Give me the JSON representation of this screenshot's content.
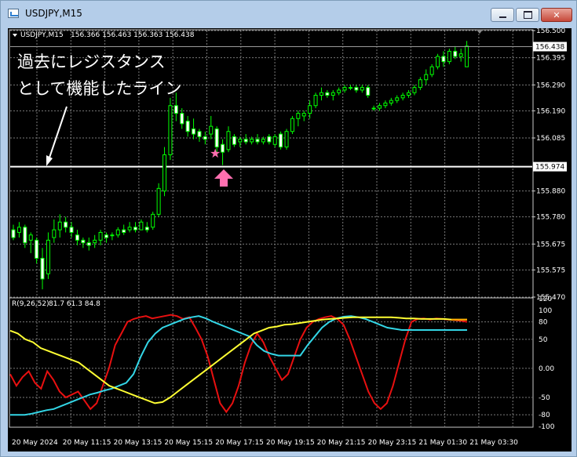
{
  "window": {
    "title": "USDJPY,M15",
    "minimize_label": "",
    "maximize_label": "",
    "close_label": "✕"
  },
  "chart_header": {
    "symbol_timeframe": "USDJPY,M15",
    "ohlc": "156.366 156.463 156.363 156.438"
  },
  "annotation": {
    "line1": "過去にレジスタンス",
    "line2": "として機能したライン",
    "star": "★",
    "arrow": "🡅"
  },
  "indicator_header": {
    "label": "R(9,26,52)",
    "values": "81.7 61.3 84.8"
  },
  "price_axis": {
    "labels": [
      "156.500",
      "156.395",
      "156.290",
      "156.190",
      "156.085",
      "155.880",
      "155.780",
      "155.675",
      "155.575",
      "155.470"
    ],
    "current_price": "156.438",
    "line_price": "155.974"
  },
  "indicator_axis": {
    "labels": [
      "120",
      "100",
      "80",
      "50",
      "0.00",
      "-50",
      "-80",
      "-100"
    ]
  },
  "time_axis": {
    "labels": [
      "20 May 2024",
      "20 May 11:15",
      "20 May 13:15",
      "20 May 15:15",
      "20 May 17:15",
      "20 May 19:15",
      "20 May 21:15",
      "20 May 23:15",
      "21 May 01:30",
      "21 May 03:30"
    ]
  },
  "colors": {
    "candle": "#00ff00",
    "annotation_text": "#ffffff",
    "marker": "#ff6fb0",
    "line_red": "#e81010",
    "line_cyan": "#33d6e6",
    "line_yellow": "#ffff33",
    "line_orange": "#ffa500"
  },
  "chart_data": {
    "type": "candlestick",
    "price_ylim": [
      155.47,
      156.5
    ],
    "horizontal_line": 155.974,
    "candles": [
      [
        155.73,
        155.75,
        155.69,
        155.7
      ],
      [
        155.72,
        155.76,
        155.7,
        155.74
      ],
      [
        155.74,
        155.75,
        155.66,
        155.68
      ],
      [
        155.69,
        155.72,
        155.64,
        155.71
      ],
      [
        155.69,
        155.7,
        155.6,
        155.62
      ],
      [
        155.62,
        155.66,
        155.5,
        155.54
      ],
      [
        155.56,
        155.72,
        155.54,
        155.69
      ],
      [
        155.7,
        155.77,
        155.68,
        155.73
      ],
      [
        155.73,
        155.79,
        155.7,
        155.76
      ],
      [
        155.76,
        155.78,
        155.72,
        155.74
      ],
      [
        155.74,
        155.76,
        155.7,
        155.72
      ],
      [
        155.71,
        155.73,
        155.67,
        155.69
      ],
      [
        155.69,
        155.7,
        155.66,
        155.68
      ],
      [
        155.68,
        155.7,
        155.65,
        155.67
      ],
      [
        155.68,
        155.71,
        155.66,
        155.69
      ],
      [
        155.69,
        155.73,
        155.67,
        155.72
      ],
      [
        155.71,
        155.72,
        155.68,
        155.7
      ],
      [
        155.71,
        155.72,
        155.69,
        155.71
      ],
      [
        155.71,
        155.74,
        155.7,
        155.73
      ],
      [
        155.73,
        155.75,
        155.71,
        155.72
      ],
      [
        155.73,
        155.76,
        155.72,
        155.74
      ],
      [
        155.74,
        155.76,
        155.72,
        155.73
      ],
      [
        155.73,
        155.77,
        155.73,
        155.76
      ],
      [
        155.74,
        155.76,
        155.72,
        155.73
      ],
      [
        155.74,
        155.8,
        155.73,
        155.79
      ],
      [
        155.79,
        155.91,
        155.78,
        155.89
      ],
      [
        155.88,
        156.05,
        155.86,
        156.02
      ],
      [
        156.02,
        156.24,
        156.0,
        156.21
      ],
      [
        156.21,
        156.26,
        156.15,
        156.18
      ],
      [
        156.18,
        156.2,
        156.12,
        156.14
      ],
      [
        156.15,
        156.17,
        156.09,
        156.11
      ],
      [
        156.12,
        156.16,
        156.08,
        156.1
      ],
      [
        156.11,
        156.12,
        156.07,
        156.09
      ],
      [
        156.09,
        156.11,
        156.06,
        156.08
      ],
      [
        156.1,
        156.17,
        156.08,
        156.13
      ],
      [
        156.12,
        156.13,
        156.02,
        156.05
      ],
      [
        156.06,
        156.08,
        155.98,
        156.03
      ],
      [
        156.04,
        156.13,
        156.03,
        156.11
      ],
      [
        156.09,
        156.1,
        156.05,
        156.06
      ],
      [
        156.07,
        156.09,
        156.05,
        156.08
      ],
      [
        156.08,
        156.1,
        156.06,
        156.07
      ],
      [
        156.07,
        156.09,
        156.06,
        156.08
      ],
      [
        156.08,
        156.1,
        156.06,
        156.07
      ],
      [
        156.07,
        156.09,
        156.06,
        156.08
      ],
      [
        156.09,
        156.1,
        156.06,
        156.07
      ],
      [
        156.06,
        156.1,
        156.05,
        156.09
      ],
      [
        156.1,
        156.11,
        156.04,
        156.05
      ],
      [
        156.05,
        156.12,
        156.04,
        156.11
      ],
      [
        156.11,
        156.17,
        156.1,
        156.16
      ],
      [
        156.16,
        156.19,
        156.13,
        156.18
      ],
      [
        156.17,
        156.19,
        156.15,
        156.18
      ],
      [
        156.18,
        156.23,
        156.16,
        156.21
      ],
      [
        156.21,
        156.26,
        156.2,
        156.25
      ],
      [
        156.25,
        156.28,
        156.23,
        156.26
      ],
      [
        156.26,
        156.27,
        156.24,
        156.25
      ],
      [
        156.25,
        156.27,
        156.23,
        156.26
      ],
      [
        156.26,
        156.28,
        156.25,
        156.27
      ],
      [
        156.27,
        156.29,
        156.26,
        156.28
      ],
      [
        156.28,
        156.29,
        156.27,
        156.28
      ],
      [
        156.28,
        156.29,
        156.26,
        156.27
      ],
      [
        156.27,
        156.29,
        156.26,
        156.28
      ],
      [
        156.28,
        156.29,
        156.24,
        156.25
      ],
      [
        156.2,
        156.21,
        156.19,
        156.2
      ],
      [
        156.2,
        156.22,
        156.19,
        156.21
      ],
      [
        156.21,
        156.23,
        156.2,
        156.22
      ],
      [
        156.22,
        156.24,
        156.21,
        156.23
      ],
      [
        156.23,
        156.25,
        156.22,
        156.24
      ],
      [
        156.24,
        156.26,
        156.23,
        156.25
      ],
      [
        156.25,
        156.27,
        156.24,
        156.26
      ],
      [
        156.26,
        156.29,
        156.25,
        156.28
      ],
      [
        156.28,
        156.32,
        156.27,
        156.31
      ],
      [
        156.31,
        156.35,
        156.29,
        156.33
      ],
      [
        156.33,
        156.37,
        156.32,
        156.36
      ],
      [
        156.36,
        156.41,
        156.35,
        156.4
      ],
      [
        156.4,
        156.42,
        156.36,
        156.38
      ],
      [
        156.38,
        156.43,
        156.37,
        156.42
      ],
      [
        156.42,
        156.44,
        156.39,
        156.4
      ],
      [
        156.4,
        156.43,
        156.38,
        156.41
      ],
      [
        156.36,
        156.46,
        156.36,
        156.44
      ]
    ],
    "indicator": {
      "ylim": [
        -100,
        120
      ],
      "levels": [
        80,
        50,
        0,
        -50,
        -80
      ],
      "series": [
        {
          "color": "red",
          "values": [
            -10,
            -30,
            -15,
            -5,
            -25,
            -35,
            -5,
            -20,
            -40,
            -50,
            -45,
            -40,
            -55,
            -70,
            -60,
            -30,
            0,
            40,
            60,
            80,
            85,
            88,
            90,
            86,
            88,
            90,
            92,
            90,
            85,
            88,
            70,
            50,
            20,
            -20,
            -60,
            -75,
            -60,
            -30,
            10,
            40,
            60,
            45,
            20,
            0,
            -20,
            -10,
            20,
            50,
            70,
            80,
            85,
            88,
            90,
            85,
            75,
            50,
            20,
            -10,
            -40,
            -60,
            -70,
            -60,
            -30,
            10,
            50,
            80,
            85,
            86,
            84,
            86,
            85,
            84,
            83,
            82,
            80
          ]
        },
        {
          "color": "cyan",
          "values": [
            -80,
            -80,
            -80,
            -78,
            -75,
            -72,
            -70,
            -65,
            -60,
            -55,
            -50,
            -45,
            -42,
            -38,
            -35,
            -30,
            -25,
            -10,
            20,
            45,
            60,
            70,
            75,
            80,
            85,
            88,
            90,
            86,
            80,
            75,
            70,
            65,
            60,
            55,
            40,
            30,
            25,
            22,
            22,
            22,
            22,
            40,
            55,
            70,
            80,
            86,
            89,
            90,
            88,
            85,
            80,
            75,
            70,
            68,
            66,
            66,
            66,
            66,
            66,
            66,
            66,
            66,
            66,
            66
          ]
        },
        {
          "color": "yellow",
          "values": [
            65,
            60,
            50,
            45,
            35,
            30,
            25,
            20,
            15,
            10,
            0,
            -10,
            -20,
            -30,
            -35,
            -40,
            -45,
            -50,
            -55,
            -60,
            -58,
            -50,
            -40,
            -30,
            -20,
            -10,
            0,
            10,
            20,
            30,
            40,
            50,
            60,
            65,
            70,
            72,
            75,
            76,
            78,
            80,
            82,
            84,
            85,
            86,
            87,
            88,
            88,
            88,
            88,
            88,
            88,
            87,
            86,
            86,
            85,
            85,
            85,
            85,
            84,
            84,
            84
          ]
        },
        {
          "color": "orange",
          "values": [
            84,
            84,
            84
          ]
        }
      ]
    }
  }
}
